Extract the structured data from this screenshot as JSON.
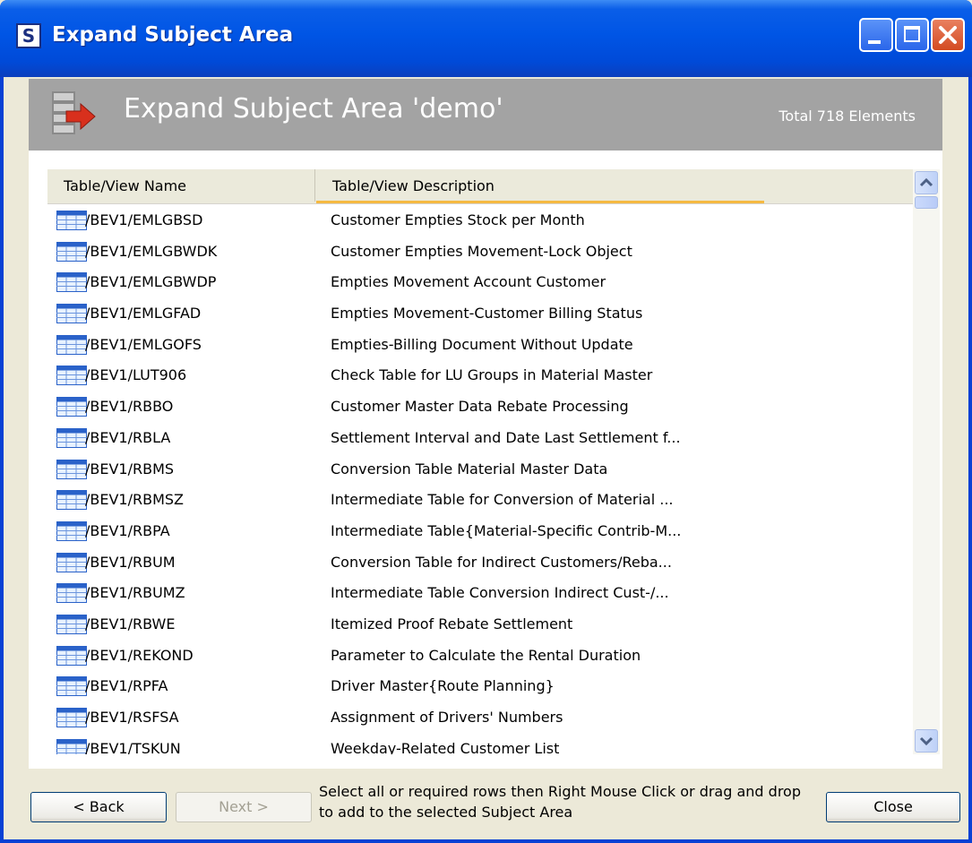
{
  "window": {
    "title": "Expand Subject Area",
    "app_icon_letter": "S"
  },
  "header": {
    "title": "Expand Subject Area 'demo'",
    "total": "Total 718 Elements"
  },
  "grid": {
    "columns": [
      "Table/View Name",
      "Table/View Description"
    ],
    "rows": [
      {
        "name": "/BEV1/EMLGBSD",
        "desc": "Customer Empties Stock per Month"
      },
      {
        "name": "/BEV1/EMLGBWDK",
        "desc": "Customer Empties Movement-Lock Object"
      },
      {
        "name": "/BEV1/EMLGBWDP",
        "desc": "Empties Movement Account Customer"
      },
      {
        "name": "/BEV1/EMLGFAD",
        "desc": "Empties Movement-Customer Billing Status"
      },
      {
        "name": "/BEV1/EMLGOFS",
        "desc": "Empties-Billing Document Without Update"
      },
      {
        "name": "/BEV1/LUT906",
        "desc": "Check Table for LU Groups in Material Master"
      },
      {
        "name": "/BEV1/RBBO",
        "desc": "Customer Master Data Rebate Processing"
      },
      {
        "name": "/BEV1/RBLA",
        "desc": "Settlement Interval and Date Last Settlement f..."
      },
      {
        "name": "/BEV1/RBMS",
        "desc": "Conversion Table Material Master Data"
      },
      {
        "name": "/BEV1/RBMSZ",
        "desc": "Intermediate Table for Conversion of Material ..."
      },
      {
        "name": "/BEV1/RBPA",
        "desc": "Intermediate Table{Material-Specific Contrib-M..."
      },
      {
        "name": "/BEV1/RBUM",
        "desc": "Conversion Table for Indirect Customers/Reba..."
      },
      {
        "name": "/BEV1/RBUMZ",
        "desc": "Intermediate Table Conversion Indirect Cust-/..."
      },
      {
        "name": "/BEV1/RBWE",
        "desc": "Itemized Proof Rebate Settlement"
      },
      {
        "name": "/BEV1/REKOND",
        "desc": "Parameter to Calculate the Rental Duration"
      },
      {
        "name": "/BEV1/RPFA",
        "desc": "Driver Master{Route Planning}"
      },
      {
        "name": "/BEV1/RSFSA",
        "desc": "Assignment of Drivers' Numbers"
      },
      {
        "name": "/BEV1/TSKUN",
        "desc": "Weekday-Related Customer List"
      }
    ]
  },
  "footer": {
    "back_label": "< Back",
    "next_label": "Next >",
    "hint": "Select all or required rows then Right Mouse Click or drag and drop to add to the selected Subject Area",
    "close_label": "Close"
  },
  "icons": {
    "row_icon": "table-icon",
    "header_icon": "database-arrow-icon"
  }
}
